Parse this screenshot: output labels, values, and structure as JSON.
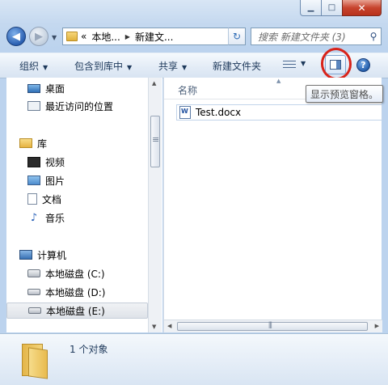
{
  "window": {
    "minimize_icon": "minimize-icon",
    "maximize_icon": "maximize-icon",
    "close_glyph": "✕"
  },
  "address": {
    "overflow": "«",
    "crumbs": [
      "本地...",
      "新建文..."
    ]
  },
  "search": {
    "placeholder": "搜索 新建文件夹 (3)"
  },
  "toolbar": {
    "organize": "组织",
    "include_in_library": "包含到库中",
    "share": "共享",
    "new_folder": "新建文件夹",
    "help": "?"
  },
  "tooltip": "显示预览窗格。",
  "nav": {
    "items": [
      {
        "label": "桌面",
        "icon": "desktop-icon"
      },
      {
        "label": "最近访问的位置",
        "icon": "recent-places-icon"
      },
      {
        "label": "库",
        "icon": "library-icon"
      },
      {
        "label": "视频",
        "icon": "video-icon"
      },
      {
        "label": "图片",
        "icon": "pictures-icon"
      },
      {
        "label": "文档",
        "icon": "documents-icon"
      },
      {
        "label": "音乐",
        "icon": "music-icon"
      },
      {
        "label": "计算机",
        "icon": "computer-icon"
      },
      {
        "label": "本地磁盘 (C:)",
        "icon": "drive-c-icon"
      },
      {
        "label": "本地磁盘 (D:)",
        "icon": "drive-icon"
      },
      {
        "label": "本地磁盘 (E:)",
        "icon": "drive-icon"
      }
    ]
  },
  "content": {
    "column_name": "名称",
    "files": [
      {
        "name": "Test.docx",
        "icon": "word-document-icon"
      }
    ]
  },
  "details": {
    "count": "1 个对象"
  },
  "colors": {
    "annotation_circle": "#d8231a",
    "accent": "#1e395b"
  }
}
